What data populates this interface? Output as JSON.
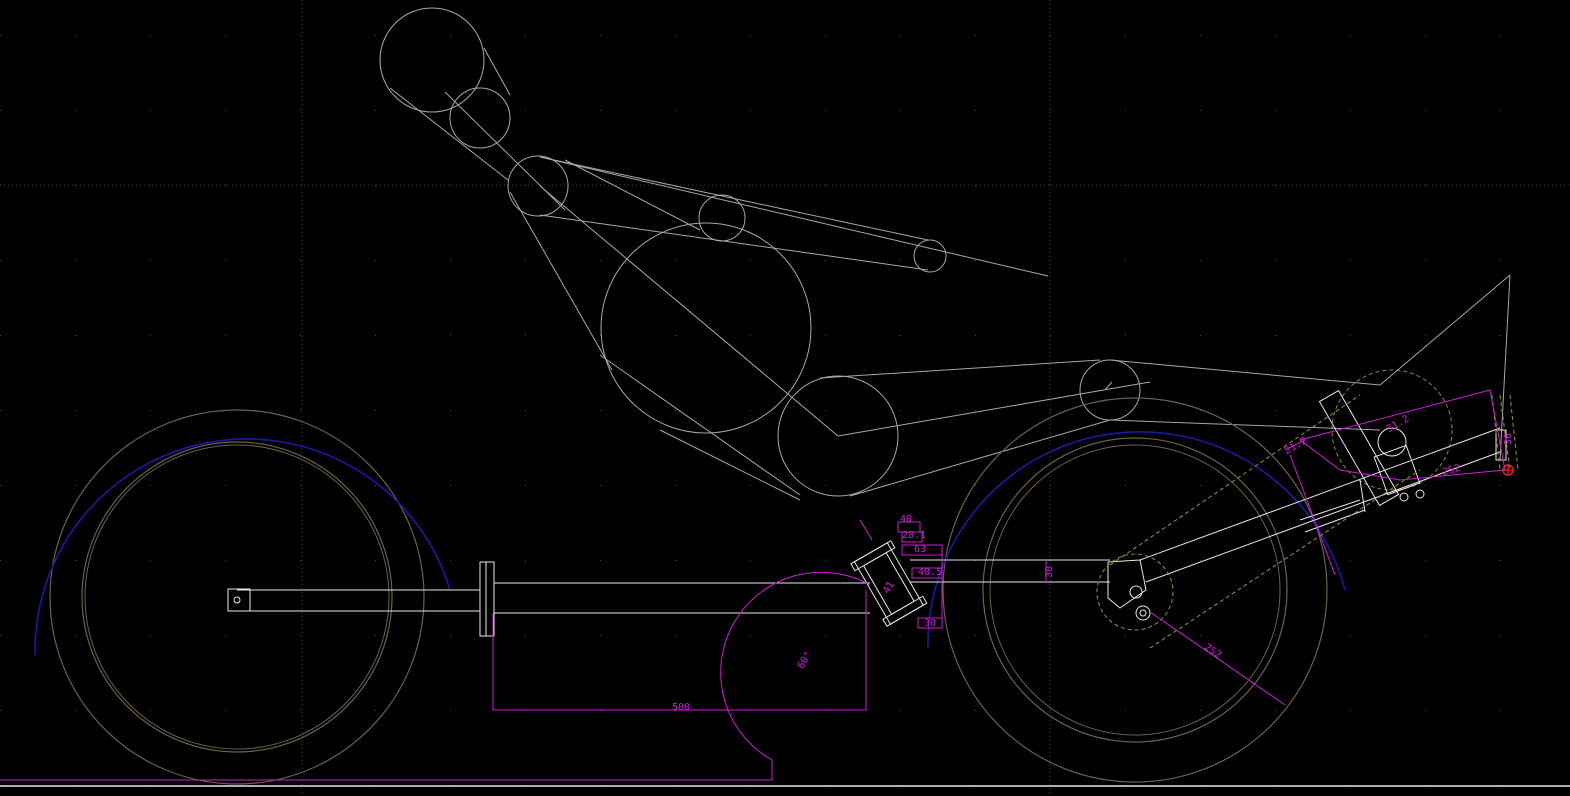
{
  "drawing": {
    "background_color": "#000000",
    "colors": {
      "geometry": "#e8e8e8",
      "construction": "#a8a8a8",
      "tire": "#6b6245",
      "fender": "#1a1aa8",
      "dimension": "#d11ad8",
      "chainring": "#8c8c2a",
      "marker": "#ff2020",
      "grid": "#4a4a4a"
    },
    "dimensions": {
      "d500": "500",
      "d60deg": "60°",
      "d40": "40",
      "d28": "28.1",
      "d63": "63",
      "d405": "40.5",
      "d30a": "30",
      "d30b": "30",
      "d252": "252",
      "d41": "41",
      "d212": "21.2",
      "d252b": "252",
      "d312": "31.2",
      "d36": "36"
    }
  }
}
